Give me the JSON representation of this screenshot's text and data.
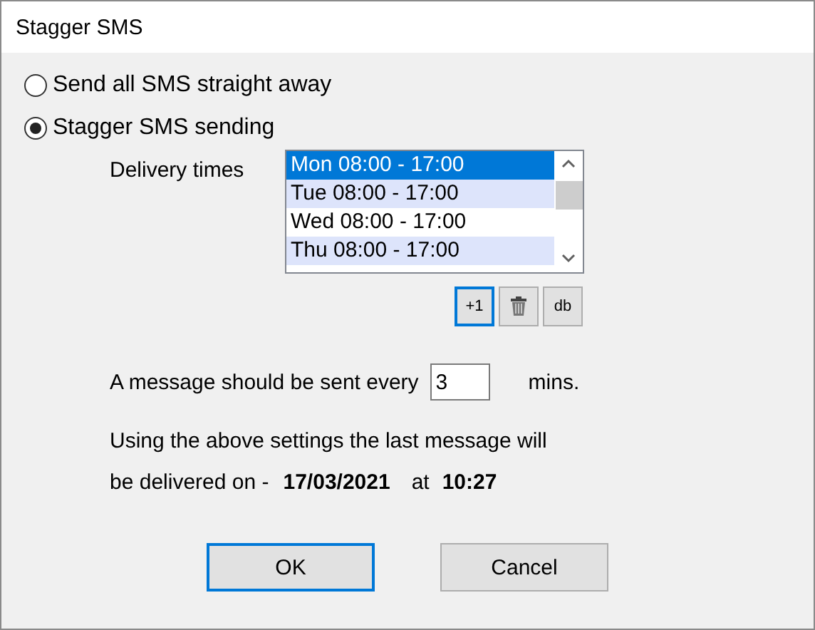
{
  "window": {
    "title": "Stagger SMS"
  },
  "send_options": [
    {
      "label": "Send all SMS straight away",
      "selected": false
    },
    {
      "label": "Stagger SMS sending",
      "selected": true
    }
  ],
  "delivery_times": {
    "label": "Delivery times",
    "items": [
      {
        "label": "Mon 08:00 - 17:00",
        "selected": true
      },
      {
        "label": "Tue 08:00 - 17:00",
        "selected": false
      },
      {
        "label": "Wed 08:00 - 17:00",
        "selected": false
      },
      {
        "label": "Thu 08:00 - 17:00",
        "selected": false
      }
    ],
    "buttons": [
      {
        "kind": "text",
        "label": "+1",
        "focused": true
      },
      {
        "kind": "trash",
        "focused": false
      },
      {
        "kind": "text",
        "label": "db",
        "focused": false
      }
    ]
  },
  "interval": {
    "label": "A message should be sent every",
    "value": "3",
    "unit": "mins."
  },
  "summary": {
    "line_1": "Using the above settings the last message will",
    "prefix": "be delivered on -",
    "date": "17/03/2021",
    "at": "at",
    "time": "10:27"
  },
  "buttons": [
    {
      "label": "OK",
      "default": true
    },
    {
      "label": "Cancel",
      "default": false
    }
  ]
}
